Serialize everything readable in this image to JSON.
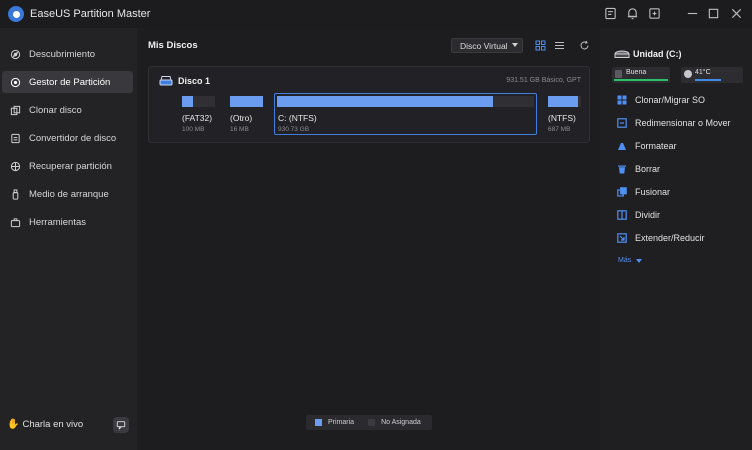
{
  "app": {
    "title": "EaseUS Partition Master"
  },
  "sidebar": {
    "items": [
      {
        "label": "Descubrimiento",
        "icon": "compass-icon",
        "active": false
      },
      {
        "label": "Gestor de Partición",
        "icon": "disk-icon",
        "active": true
      },
      {
        "label": "Clonar disco",
        "icon": "clone-icon",
        "active": false
      },
      {
        "label": "Convertidor de disco",
        "icon": "convert-icon",
        "active": false
      },
      {
        "label": "Recuperar partición",
        "icon": "recover-icon",
        "active": false
      },
      {
        "label": "Medio de arranque",
        "icon": "usb-icon",
        "active": false
      },
      {
        "label": "Herramientas",
        "icon": "toolbox-icon",
        "active": false
      }
    ],
    "chat_label": "Charla en vivo"
  },
  "main": {
    "title": "Mis Discos",
    "virtual_disk_select": "Disco Virtual",
    "disk": {
      "name": "Disco 1",
      "info": "931.51 GB Básico, GPT",
      "partitions": [
        {
          "label": "(FAT32)",
          "size": "100 MB",
          "used_fraction": 0.33
        },
        {
          "label": "(Otro)",
          "size": "16 MB",
          "used_fraction": 1.0
        },
        {
          "label": "C: (NTFS)",
          "size": "930.73 GB",
          "used_fraction": 0.84,
          "selected": true
        },
        {
          "label": "(NTFS)",
          "size": "687 MB",
          "used_fraction": 0.9
        }
      ]
    },
    "legend": [
      {
        "label": "Primaria",
        "color": "#6a9df0"
      },
      {
        "label": "No Asignada",
        "color": "#3a3a3f"
      }
    ]
  },
  "right_panel": {
    "title": "Unidad (C:)",
    "health": {
      "label": "Buena",
      "color": "#2bbf6a"
    },
    "temperature": {
      "label": "41°C",
      "color": "#3f8be8"
    },
    "actions": [
      {
        "label": "Clonar/Migrar SO",
        "icon": "windows-icon"
      },
      {
        "label": "Redimensionar o Mover",
        "icon": "resize-icon"
      },
      {
        "label": "Formatear",
        "icon": "format-icon"
      },
      {
        "label": "Borrar",
        "icon": "trash-icon"
      },
      {
        "label": "Fusionar",
        "icon": "merge-icon"
      },
      {
        "label": "Dividir",
        "icon": "split-icon"
      },
      {
        "label": "Extender/Reducir",
        "icon": "extend-icon"
      }
    ],
    "more_label": "Más"
  },
  "colors": {
    "accent": "#3f7fe0",
    "partition_fill": "#6a9df0"
  }
}
